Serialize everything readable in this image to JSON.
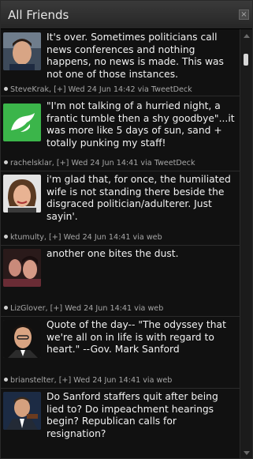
{
  "panel": {
    "title": "All Friends",
    "close_label": "×"
  },
  "tweets": [
    {
      "text": "It's over. Sometimes politicians call news conferences and nothing happens, no news is made. This was not one of those instances.",
      "meta": "SteveKrak, [+] Wed 24 Jun 14:42 via TweetDeck",
      "avatar": "person-photo"
    },
    {
      "text": "\"I'm not talking of a hurried night, a frantic tumble then a shy goodbye\"...it was more like 5 days of sun, sand + totally punking my staff!",
      "meta": "rachelsklar, [+] Wed 24 Jun 14:41 via TweetDeck",
      "avatar": "twitter-default-bird"
    },
    {
      "text": "i'm glad that, for once, the humiliated wife is not standing there beside the disgraced politician/adulterer. Just sayin'.",
      "meta": "ktumulty, [+] Wed 24 Jun 14:41 via web",
      "avatar": "person-photo"
    },
    {
      "text": "another one bites the dust.",
      "meta": "LizGlover, [+] Wed 24 Jun 14:41 via web",
      "avatar": "person-photo"
    },
    {
      "text": "Quote of the day-- \"The odyssey that we're all on in life is with regard to heart.\" --Gov. Mark Sanford",
      "meta": "brianstelter, [+] Wed 24 Jun 14:41 via web",
      "avatar": "person-photo"
    },
    {
      "text": "Do Sanford staffers quit after being lied to? Do impeachment hearings begin? Republican calls for resignation?",
      "meta": "",
      "avatar": "person-photo"
    }
  ]
}
